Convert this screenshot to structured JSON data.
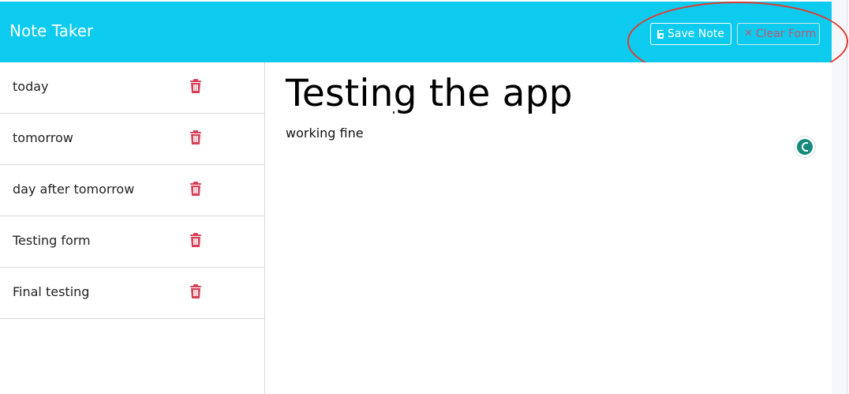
{
  "app": {
    "title": "Note Taker"
  },
  "toolbar": {
    "save_label": "Save Note",
    "clear_label": "Clear Form"
  },
  "notes": [
    {
      "title": "today"
    },
    {
      "title": "tomorrow"
    },
    {
      "title": "day after tomorrow"
    },
    {
      "title": "Testing form"
    },
    {
      "title": "Final testing"
    }
  ],
  "active_note": {
    "title": "Testing the app",
    "text": "working fine"
  },
  "icons": {
    "save": "save-icon",
    "clear": "close-icon",
    "delete": "trash-icon",
    "assistant": "assistant-icon"
  },
  "colors": {
    "navbar": "#0dcbee",
    "delete": "#d64057",
    "annotation": "#e23a2e"
  }
}
